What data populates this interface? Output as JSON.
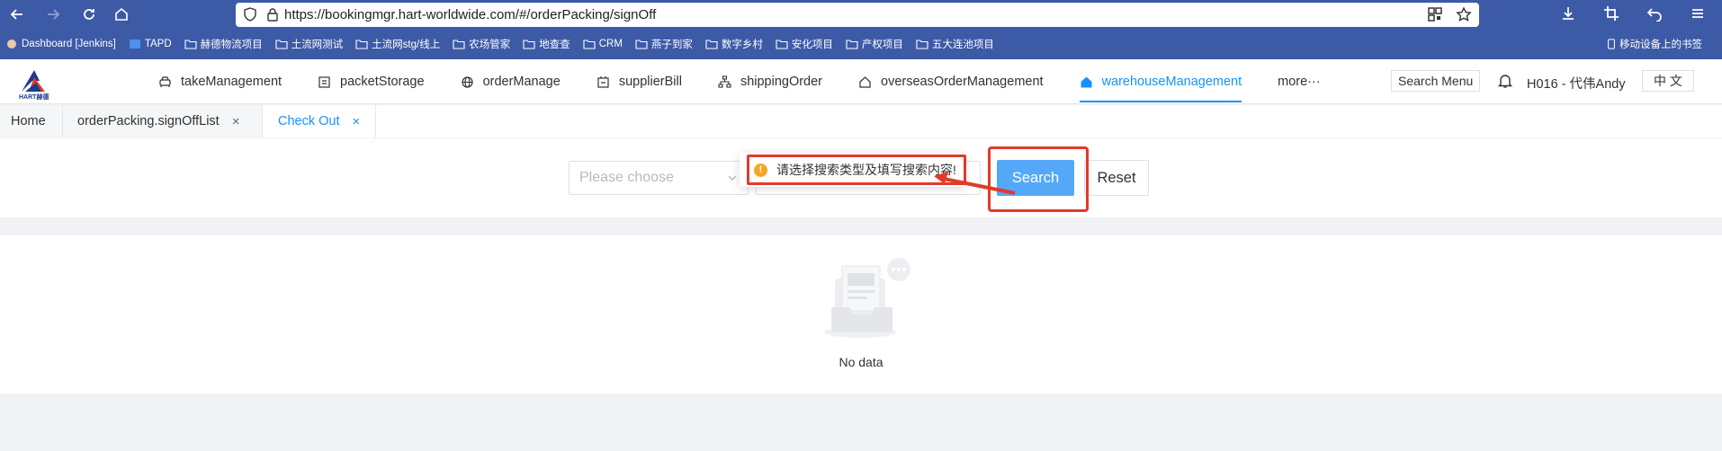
{
  "browser": {
    "url": "https://bookingmgr.hart-worldwide.com/#/orderPacking/signOff"
  },
  "bookmarks": [
    "Dashboard [Jenkins]",
    "TAPD",
    "赫德物流项目",
    "土流网测试",
    "土流网stg/线上",
    "农场管家",
    "地查查",
    "CRM",
    "燕子到家",
    "数字乡村",
    "安化项目",
    "产权项目",
    "五大连池项目"
  ],
  "bookmarks_mobile": "移动设备上的书签",
  "header": {
    "logo_text": "HART赫德",
    "menu": [
      {
        "label": "takeManagement",
        "icon": "car-icon"
      },
      {
        "label": "packetStorage",
        "icon": "box-icon"
      },
      {
        "label": "orderManage",
        "icon": "globe-icon"
      },
      {
        "label": "supplierBill",
        "icon": "bill-icon"
      },
      {
        "label": "shippingOrder",
        "icon": "tree-icon"
      },
      {
        "label": "overseasOrderManagement",
        "icon": "home-outline-icon"
      },
      {
        "label": "warehouseManagement",
        "icon": "home-filled-icon",
        "active": true
      },
      {
        "label": "more···",
        "icon": ""
      }
    ],
    "search_menu": "Search Menu",
    "user": "H016 - 代伟Andy",
    "language": "中 文"
  },
  "tabs": {
    "home": "Home",
    "sign_off_list": "orderPacking.signOffList",
    "check_out": "Check Out",
    "close_glyph": "×"
  },
  "search": {
    "select_placeholder": "Please choose",
    "search_label": "Search",
    "reset_label": "Reset"
  },
  "toast": {
    "message": "请选择搜索类型及填写搜索内容!",
    "icon": "!"
  },
  "empty": {
    "text": "No data"
  },
  "colors": {
    "browser_bar": "#3d5aa6",
    "primary": "#1890ff",
    "search_button": "#54a8f7",
    "annotation": "#e33a2a",
    "warning": "#f5a623"
  }
}
